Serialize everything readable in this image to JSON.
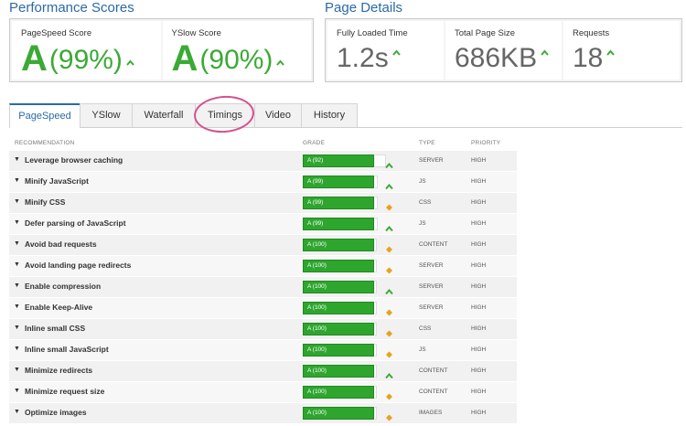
{
  "performance": {
    "title": "Performance Scores",
    "pagespeed": {
      "label": "PageSpeed Score",
      "grade": "A",
      "pct": "(99%)"
    },
    "yslow": {
      "label": "YSlow Score",
      "grade": "A",
      "pct": "(90%)"
    }
  },
  "details": {
    "title": "Page Details",
    "load": {
      "label": "Fully Loaded Time",
      "value": "1.2s"
    },
    "size": {
      "label": "Total Page Size",
      "value": "686KB"
    },
    "requests": {
      "label": "Requests",
      "value": "18"
    }
  },
  "tabs": [
    "PageSpeed",
    "YSlow",
    "Waterfall",
    "Timings",
    "Video",
    "History"
  ],
  "table": {
    "headers": {
      "recommendation": "RECOMMENDATION",
      "grade": "GRADE",
      "type": "TYPE",
      "priority": "PRIORITY"
    },
    "rows": [
      {
        "name": "Leverage browser caching",
        "grade": "A (92)",
        "score": 92,
        "icon": "chevron-up-icon",
        "type": "SERVER",
        "priority": "HIGH"
      },
      {
        "name": "Minify JavaScript",
        "grade": "A (99)",
        "score": 99,
        "icon": "chevron-up-icon",
        "type": "JS",
        "priority": "HIGH"
      },
      {
        "name": "Minify CSS",
        "grade": "A (99)",
        "score": 99,
        "icon": "diamond-icon",
        "type": "CSS",
        "priority": "HIGH"
      },
      {
        "name": "Defer parsing of JavaScript",
        "grade": "A (99)",
        "score": 99,
        "icon": "chevron-up-icon",
        "type": "JS",
        "priority": "HIGH"
      },
      {
        "name": "Avoid bad requests",
        "grade": "A (100)",
        "score": 100,
        "icon": "diamond-icon",
        "type": "CONTENT",
        "priority": "HIGH"
      },
      {
        "name": "Avoid landing page redirects",
        "grade": "A (100)",
        "score": 100,
        "icon": "diamond-icon",
        "type": "SERVER",
        "priority": "HIGH"
      },
      {
        "name": "Enable compression",
        "grade": "A (100)",
        "score": 100,
        "icon": "chevron-up-icon",
        "type": "SERVER",
        "priority": "HIGH"
      },
      {
        "name": "Enable Keep-Alive",
        "grade": "A (100)",
        "score": 100,
        "icon": "diamond-icon",
        "type": "SERVER",
        "priority": "HIGH"
      },
      {
        "name": "Inline small CSS",
        "grade": "A (100)",
        "score": 100,
        "icon": "diamond-icon",
        "type": "CSS",
        "priority": "HIGH"
      },
      {
        "name": "Inline small JavaScript",
        "grade": "A (100)",
        "score": 100,
        "icon": "diamond-icon",
        "type": "JS",
        "priority": "HIGH"
      },
      {
        "name": "Minimize redirects",
        "grade": "A (100)",
        "score": 100,
        "icon": "chevron-up-icon",
        "type": "CONTENT",
        "priority": "HIGH"
      },
      {
        "name": "Minimize request size",
        "grade": "A (100)",
        "score": 100,
        "icon": "diamond-icon",
        "type": "CONTENT",
        "priority": "HIGH"
      },
      {
        "name": "Optimize images",
        "grade": "A (100)",
        "score": 100,
        "icon": "diamond-icon",
        "type": "IMAGES",
        "priority": "HIGH"
      }
    ]
  },
  "colors": {
    "accent": "#2b6aa6",
    "grade_green": "#3aaa35",
    "bar_green": "#2ea62e",
    "annotation": "#d5508f",
    "diamond": "#e8a21c"
  }
}
